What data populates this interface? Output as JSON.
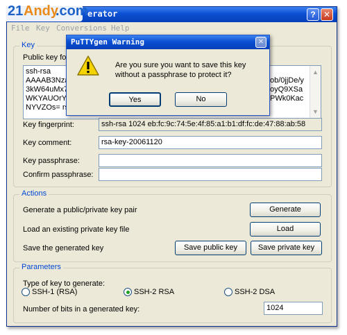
{
  "watermark": {
    "part1": "21",
    "part2": "Andy",
    "part3": ".com"
  },
  "window": {
    "title": "erator",
    "menu": [
      "File",
      "Key",
      "Conversions",
      "Help"
    ],
    "help_glyph": "?",
    "close_glyph": "✕"
  },
  "key": {
    "group_title": "Key",
    "public_key_label": "Public key for",
    "public_key_lines": [
      "ssh-rsa",
      "AAAAB3NzaC",
      "3kW64uMx7",
      "WKYAUOrYS",
      "NYVZOs= rsa"
    ],
    "public_key_right_lines": [
      "",
      "ob/0jjDe/y",
      "oyQ9XSa",
      "PWk0Kac",
      ""
    ],
    "fingerprint_label": "Key fingerprint:",
    "fingerprint_value": "ssh-rsa 1024 eb:fc:9c:74:5e:4f:85:a1:b1:df:fc:de:47:88:ab:58",
    "comment_label": "Key comment:",
    "comment_value": "rsa-key-20061120",
    "passphrase_label": "Key passphrase:",
    "passphrase_value": "",
    "confirm_label": "Confirm passphrase:",
    "confirm_value": ""
  },
  "actions": {
    "group_title": "Actions",
    "generate_label": "Generate a public/private key pair",
    "generate_button": "Generate",
    "load_label": "Load an existing private key file",
    "load_button": "Load",
    "save_label": "Save the generated key",
    "save_public_button": "Save public key",
    "save_private_button": "Save private key"
  },
  "parameters": {
    "group_title": "Parameters",
    "type_label": "Type of key to generate:",
    "options": [
      "SSH-1 (RSA)",
      "SSH-2 RSA",
      "SSH-2 DSA"
    ],
    "selected": "SSH-2 RSA",
    "bits_label": "Number of bits in a generated key:",
    "bits_value": "1024"
  },
  "dialog": {
    "title": "PuTTYgen Warning",
    "message_line1": "Are you sure you want to save this key",
    "message_line2": "without a passphrase to protect it?",
    "yes_button": "Yes",
    "no_button": "No",
    "close_glyph": "✕",
    "icon": "warning-icon"
  },
  "colors": {
    "accent": "#0046d5",
    "titlebar": "#0a4fd3",
    "window_bg": "#ece9d8",
    "warning": "#f5d300"
  }
}
